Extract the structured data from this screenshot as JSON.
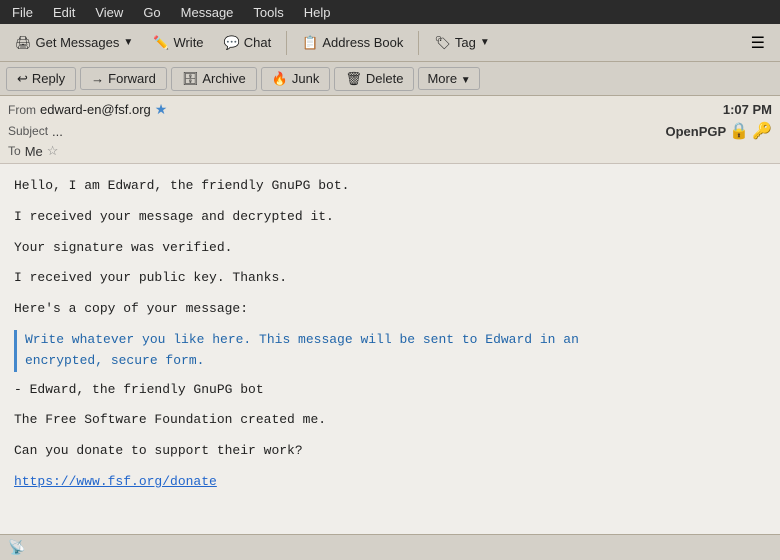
{
  "menubar": {
    "items": [
      "File",
      "Edit",
      "View",
      "Go",
      "Message",
      "Tools",
      "Help"
    ]
  },
  "toolbar": {
    "get_messages": "Get Messages",
    "write": "Write",
    "chat": "Chat",
    "address_book": "Address Book",
    "tag": "Tag"
  },
  "actionbar": {
    "reply": "Reply",
    "forward": "Forward",
    "archive": "Archive",
    "junk": "Junk",
    "delete": "Delete",
    "more": "More"
  },
  "message": {
    "from_label": "From",
    "from_addr": "edward-en@fsf.org",
    "time": "1:07 PM",
    "subject_label": "Subject",
    "subject_val": "...",
    "openpgp_label": "OpenPGP",
    "to_label": "To",
    "to_val": "Me"
  },
  "body": {
    "line1": "Hello, I am Edward, the friendly GnuPG bot.",
    "line2": "I received your message and decrypted it.",
    "line3": "Your signature was verified.",
    "line4": "I received your public key. Thanks.",
    "line5": "Here's a copy of your message:",
    "quoted1": "Write whatever you like here. This message will be sent to Edward in an",
    "quoted2": "encrypted, secure form.",
    "line6": "- Edward, the friendly GnuPG bot",
    "line7": "The Free Software Foundation created me.",
    "line8": "Can you donate to support their work?",
    "link": "https://www.fsf.org/donate"
  },
  "statusbar": {
    "icon": "📡"
  }
}
